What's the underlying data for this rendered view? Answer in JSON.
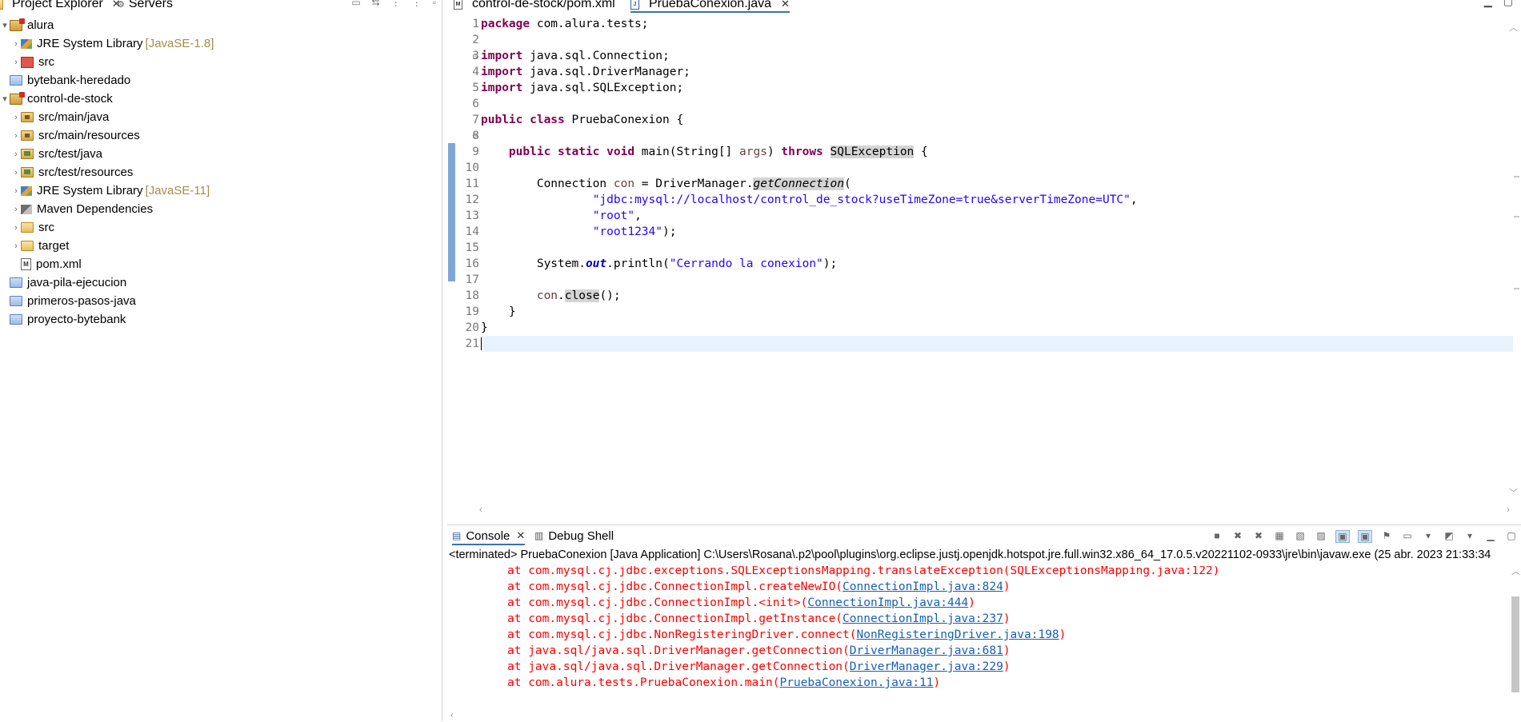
{
  "left_tabs": [
    {
      "label": "Project Explorer",
      "close": "✕"
    },
    {
      "label": "Servers"
    }
  ],
  "tree": [
    {
      "label": "alura",
      "icon": "project-icon",
      "twisty": "▾",
      "indent": 0
    },
    {
      "label": "JRE System Library",
      "version": "[JavaSE-1.8]",
      "icon": "library-icon",
      "twisty": "›",
      "indent": 1
    },
    {
      "label": "src",
      "icon": "source-folder-icon",
      "twisty": "›",
      "indent": 1
    },
    {
      "label": "bytebank-heredado",
      "icon": "folder-icon",
      "twisty": "",
      "indent": 0
    },
    {
      "label": "control-de-stock",
      "icon": "project-icon",
      "twisty": "▾",
      "indent": 0
    },
    {
      "label": "src/main/java",
      "icon": "package-folder-icon",
      "twisty": "›",
      "indent": 1
    },
    {
      "label": "src/main/resources",
      "icon": "package-folder-icon",
      "twisty": "›",
      "indent": 1
    },
    {
      "label": "src/test/java",
      "icon": "test-folder-icon",
      "twisty": "›",
      "indent": 1
    },
    {
      "label": "src/test/resources",
      "icon": "test-folder-icon",
      "twisty": "›",
      "indent": 1
    },
    {
      "label": "JRE System Library",
      "version": "[JavaSE-11]",
      "icon": "library-icon",
      "twisty": "›",
      "indent": 1
    },
    {
      "label": "Maven Dependencies",
      "icon": "dependencies-icon",
      "twisty": "›",
      "indent": 1
    },
    {
      "label": "src",
      "icon": "plain-folder-icon",
      "twisty": "›",
      "indent": 1
    },
    {
      "label": "target",
      "icon": "plain-folder-icon",
      "twisty": "›",
      "indent": 1
    },
    {
      "label": "pom.xml",
      "icon": "xml-file-icon",
      "twisty": "",
      "indent": 1
    },
    {
      "label": "java-pila-ejecucion",
      "icon": "folder-icon",
      "twisty": "",
      "indent": 0
    },
    {
      "label": "primeros-pasos-java",
      "icon": "folder-icon",
      "twisty": "",
      "indent": 0
    },
    {
      "label": "proyecto-bytebank",
      "icon": "folder-icon",
      "twisty": "",
      "indent": 0
    }
  ],
  "editor_tabs": [
    {
      "label": "control-de-stock/pom.xml",
      "icon": "M"
    },
    {
      "label": "PruebaConexion.java",
      "icon": "J",
      "close": "✕"
    }
  ],
  "code": {
    "line_numbers": [
      "1",
      "2",
      "3",
      "4",
      "5",
      "6",
      "7",
      "8",
      "9",
      "10",
      "11",
      "12",
      "13",
      "14",
      "15",
      "16",
      "17",
      "18",
      "19",
      "20",
      "21"
    ],
    "l1_kw": "package",
    "l1_rest": " com.alura.tests;",
    "import_kw": "import",
    "l3_rest": " java.sql.Connection;",
    "l4_rest": " java.sql.DriverManager;",
    "l5_rest": " java.sql.SQLException;",
    "l7_kw": "public class",
    "l7_rest": " PruebaConexion {",
    "l9_indent": "    ",
    "l9_kw1": "public static void",
    "l9_a": " main(String[] ",
    "l9_param": "args",
    "l9_b": ") ",
    "l9_kw2": "throws",
    "l9_c": " ",
    "l9_mark": "SQLException",
    "l9_d": " {",
    "l11_indent": "        ",
    "l11_a": "Connection ",
    "l11_local": "con",
    "l11_b": " = DriverManager.",
    "l11_call": "getConnection",
    "l11_c": "(",
    "l12_indent": "                ",
    "l12_str": "\"jdbc:mysql://localhost/control_de_stock?useTimeZone=true&serverTimeZone=UTC\"",
    "l12_c": ",",
    "l13_indent": "                ",
    "l13_str": "\"root\"",
    "l13_c": ",",
    "l14_indent": "                ",
    "l14_str": "\"root1234\"",
    "l14_c": ");",
    "l16_indent": "        ",
    "l16_a": "System.",
    "l16_field": "out",
    "l16_b": ".println(",
    "l16_str": "\"Cerrando la conexion\"",
    "l16_c": ");",
    "l18_indent": "        ",
    "l18_local": "con",
    "l18_a": ".",
    "l18_mark": "close",
    "l18_b": "();",
    "l19": "    }",
    "l20": "}"
  },
  "console": {
    "tabs": [
      {
        "label": "Console",
        "close": "✕"
      },
      {
        "label": "Debug Shell"
      }
    ],
    "description": "<terminated> PruebaConexion [Java Application] C:\\Users\\Rosana\\.p2\\pool\\plugins\\org.eclipse.justj.openjdk.hotspot.jre.full.win32.x86_64_17.0.5.v20221102-0933\\jre\\bin\\javaw.exe  (25 abr. 2023 21:33:34",
    "trace": [
      {
        "prefix": "at com.mysql.cj.jdbc.exceptions.SQLExceptionsMapping.translateException(SQLExceptionsMapping.java:122)",
        "link": "",
        "suffix": ""
      },
      {
        "prefix": "at com.mysql.cj.jdbc.ConnectionImpl.createNewIO(",
        "link": "ConnectionImpl.java:824",
        "suffix": ")"
      },
      {
        "prefix": "at com.mysql.cj.jdbc.ConnectionImpl.<init>(",
        "link": "ConnectionImpl.java:444",
        "suffix": ")"
      },
      {
        "prefix": "at com.mysql.cj.jdbc.ConnectionImpl.getInstance(",
        "link": "ConnectionImpl.java:237",
        "suffix": ")"
      },
      {
        "prefix": "at com.mysql.cj.jdbc.NonRegisteringDriver.connect(",
        "link": "NonRegisteringDriver.java:198",
        "suffix": ")"
      },
      {
        "prefix": "at java.sql/java.sql.DriverManager.getConnection(",
        "link": "DriverManager.java:681",
        "suffix": ")"
      },
      {
        "prefix": "at java.sql/java.sql.DriverManager.getConnection(",
        "link": "DriverManager.java:229",
        "suffix": ")"
      },
      {
        "prefix": "at com.alura.tests.PruebaConexion.main(",
        "link": "PruebaConexion.java:11",
        "suffix": ")"
      }
    ]
  },
  "colors": {
    "keyword": "#7f0055",
    "string": "#2a00ff",
    "error": "#ff0000",
    "link": "#1a5fb4",
    "current_line": "#e8f2fe"
  }
}
